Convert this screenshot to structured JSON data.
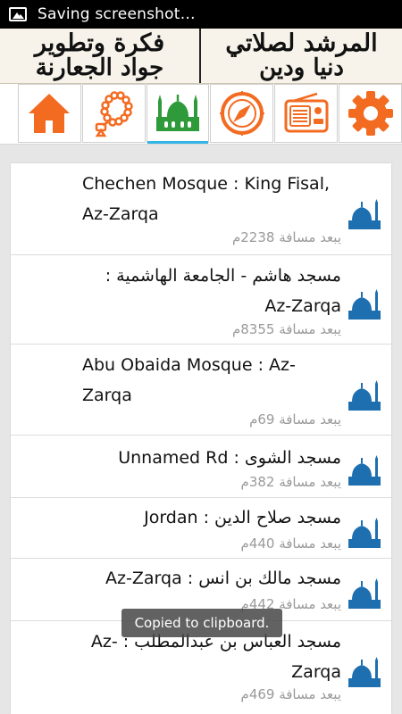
{
  "status": {
    "text": "Saving screenshot…",
    "icon": "image-icon"
  },
  "banner": {
    "right_line1": "المرشد لصلاتي",
    "right_line2": "دنيا ودين",
    "left_line1": "فكرة وتطوير",
    "left_line2": "جواد الجعارنة"
  },
  "toolbar": {
    "active": "mosque",
    "items": [
      {
        "name": "home",
        "icon": "home-icon",
        "color": "#f36b21"
      },
      {
        "name": "tasbih",
        "icon": "prayer-beads-icon",
        "color": "#f36b21"
      },
      {
        "name": "mosque",
        "icon": "mosque-icon",
        "color": "#2e9a3a"
      },
      {
        "name": "qibla",
        "icon": "compass-icon",
        "color": "#f36b21"
      },
      {
        "name": "radio",
        "icon": "radio-icon",
        "color": "#f36b21"
      },
      {
        "name": "settings",
        "icon": "gear-icon",
        "color": "#f36b21"
      }
    ]
  },
  "mosques": [
    {
      "title": "Chechen Mosque : King Fisal, Az-Zarqa",
      "distance": "يبعد مسافة 2238م"
    },
    {
      "title": "مسجد هاشم - الجامعة الهاشمية : Az-Zarqa",
      "distance": "يبعد مسافة 8355م"
    },
    {
      "title": "Abu Obaida Mosque : Az-Zarqa",
      "distance": "يبعد مسافة 69م"
    },
    {
      "title": "مسجد الشوى : Unnamed Rd",
      "distance": "يبعد مسافة 382م"
    },
    {
      "title": "مسجد صلاح الدين : Jordan",
      "distance": "يبعد مسافة 440م"
    },
    {
      "title": "مسجد مالك بن انس : Az-Zarqa",
      "distance": "يبعد مسافة 442م"
    },
    {
      "title": "مسجد العباس بن عبدالمطلب : Az-Zarqa",
      "distance": "يبعد مسافة 469م"
    }
  ],
  "toast": "Copied to clipboard.",
  "colors": {
    "accent": "#33b5e5",
    "icon_orange": "#f36b21",
    "mosque_green": "#2e9a3a",
    "mosque_blue": "#1e6fb0"
  }
}
